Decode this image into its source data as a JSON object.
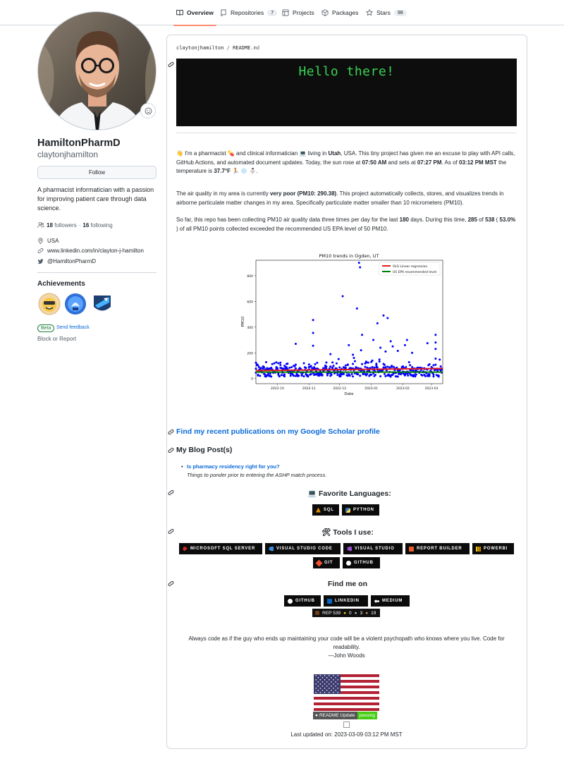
{
  "nav": {
    "tabs": [
      {
        "label": "Overview",
        "icon": "book-icon"
      },
      {
        "label": "Repositories",
        "count": "7",
        "icon": "repo-icon"
      },
      {
        "label": "Projects",
        "icon": "table-icon"
      },
      {
        "label": "Packages",
        "icon": "package-icon"
      },
      {
        "label": "Stars",
        "count": "98",
        "icon": "star-icon"
      }
    ]
  },
  "profile": {
    "name": "HamiltonPharmD",
    "login": "claytonjhamilton",
    "follow_label": "Follow",
    "bio": "A pharmacist informatician with a passion for improving patient care through data science.",
    "followers": "18",
    "followers_label": "followers",
    "separator": "·",
    "following": "16",
    "following_label": "following",
    "location": "USA",
    "website": "www.linkedin.com/in/clayton-j-hamilton",
    "twitter": "@HamiltonPharmD",
    "achievements_title": "Achievements",
    "beta_label": "Beta",
    "feedback_label": "Send feedback",
    "block_label": "Block or Report"
  },
  "readme": {
    "breadcrumb_user": "claytonjhamilton",
    "breadcrumb_sep": "/",
    "breadcrumb_file": "README",
    "breadcrumb_ext": ".md",
    "hello": "Hello there!",
    "intro": {
      "wave": "👋",
      "t1": " I'm a pharmacist ",
      "pill": "💊",
      "t2": " and clinical informatician ",
      "comp": "💻",
      "t3": " living in ",
      "state": "Utah",
      "t4": ", USA. This tiny project has given me an excuse to play with API calls, GitHub Actions, and automated document updates. Today, the sun rose at ",
      "sunrise": "07:50 AM",
      "t5": " and sets at ",
      "sunset": "07:27 PM",
      "t6": ". As of ",
      "asof": "03:12 PM MST",
      "t7": " the temperature is ",
      "temp": "37.7°F",
      "wx": " 🏃 ❄️ ⛄",
      "t8": "."
    },
    "air": {
      "t1": "The air quality in my area is currently ",
      "quality": "very poor (PM10: 290.38)",
      "t2": ". This project automatically collects, stores, and visualizes trends in airborne particulate matter changes in my area. Specifically particulate matter smaller than 10 micrometers (PM10)."
    },
    "stats": {
      "t1": "So far, this repo has been collecting PM10 air quality data three times per day for the last ",
      "days": "180",
      "t2": " days. During this time, ",
      "exceed": "285",
      "t3": " of ",
      "total": "538",
      "t4": " ( ",
      "pct": "53.0%",
      "t5": " ) of all PM10 points collected exceeded the recommended US EPA level of 50 PM10."
    },
    "scholar_link": "Find my recent publications on my Google Scholar profile",
    "blog_heading": "My Blog Post(s)",
    "blog_title": "Is pharmacy residency right for you?",
    "blog_desc": "Things to ponder prior to entering the ASHP match process.",
    "fav_heading": "Favorite Languages:",
    "fav_emoji": "💻",
    "languages": [
      {
        "label": "SQL",
        "color": "#e38c00"
      },
      {
        "label": "PYTHON",
        "color": "#ffdd54"
      }
    ],
    "tools_heading": "Tools I use:",
    "tools_emoji": "🛠",
    "tools_row1": [
      {
        "label": "MICROSOFT SQL SERVER",
        "color": "#cc2927"
      },
      {
        "label": "VISUAL STUDIO CODE",
        "color": "#3a8ee6"
      },
      {
        "label": "VISUAL STUDIO",
        "color": "#9b4fd1"
      },
      {
        "label": "REPORT BUILDER",
        "color": "#e85d2a"
      },
      {
        "label": "POWERBI",
        "color": "#f2c811"
      }
    ],
    "tools_row2": [
      {
        "label": "GIT",
        "color": "#f05033"
      },
      {
        "label": "GITHUB",
        "color": "#ffffff"
      }
    ],
    "findme_heading": "Find me on",
    "socials": [
      {
        "label": "GITHUB",
        "color": "#ffffff"
      },
      {
        "label": "LINKEDIN",
        "color": "#0a66c2"
      },
      {
        "label": "MEDIUM",
        "color": "#ffffff"
      }
    ],
    "rep": {
      "label": "REP 539",
      "gold": "0",
      "silver": "3",
      "bronze": "19"
    },
    "quote": "Always code as if the guy who ends up maintaining your code will be a violent psychopath who knows where you live. Code for readability.",
    "quote_author": "—John Woods",
    "ci_left": "README Update",
    "ci_right": "passing",
    "updated": "Last updated on: 2023-03-09 03:12 PM MST"
  },
  "chart_data": {
    "type": "scatter",
    "title": "PM10 trends in Ogden, UT",
    "xlabel": "Date",
    "ylabel": "PM10",
    "xticks": [
      "2022-10",
      "2022-11",
      "2022-12",
      "2023-01",
      "2023-02",
      "2023-03"
    ],
    "yticks": [
      0,
      200,
      400,
      600,
      800
    ],
    "ylim": [
      -40,
      920
    ],
    "xlim": [
      "2022-09-10",
      "2023-03-12"
    ],
    "legend": [
      "OLS Linear regression",
      "US EPA recommended level"
    ],
    "legend_position": "top-right",
    "colors": {
      "points": "#0000ff",
      "regression": "#e31a1c",
      "epa": "#008000"
    },
    "epa_level": 50,
    "regression": {
      "start": [
        "2022-09-10",
        62
      ],
      "end": [
        "2023-03-12",
        78
      ]
    },
    "outliers": [
      {
        "x": "2022-12-20",
        "y": 900
      },
      {
        "x": "2022-12-21",
        "y": 865
      },
      {
        "x": "2022-12-04",
        "y": 640
      },
      {
        "x": "2022-12-18",
        "y": 545
      },
      {
        "x": "2023-01-07",
        "y": 430
      },
      {
        "x": "2023-01-13",
        "y": 490
      },
      {
        "x": "2023-01-17",
        "y": 470
      },
      {
        "x": "2022-11-05",
        "y": 455
      },
      {
        "x": "2022-11-05",
        "y": 355
      },
      {
        "x": "2022-12-23",
        "y": 340
      },
      {
        "x": "2023-03-05",
        "y": 340
      },
      {
        "x": "2023-01-03",
        "y": 300
      },
      {
        "x": "2023-01-20",
        "y": 290
      },
      {
        "x": "2022-10-19",
        "y": 270
      },
      {
        "x": "2023-02-05",
        "y": 300
      },
      {
        "x": "2023-03-05",
        "y": 280
      },
      {
        "x": "2023-02-25",
        "y": 275
      },
      {
        "x": "2023-01-22",
        "y": 250
      },
      {
        "x": "2023-02-03",
        "y": 260
      },
      {
        "x": "2023-03-05",
        "y": 230
      },
      {
        "x": "2023-01-10",
        "y": 240
      },
      {
        "x": "2022-11-05",
        "y": 255
      },
      {
        "x": "2022-12-10",
        "y": 260
      },
      {
        "x": "2022-12-22",
        "y": 220
      },
      {
        "x": "2023-01-15",
        "y": 210
      },
      {
        "x": "2023-02-10",
        "y": 200
      },
      {
        "x": "2023-01-27",
        "y": 215
      },
      {
        "x": "2022-11-22",
        "y": 190
      },
      {
        "x": "2022-12-14",
        "y": 185
      }
    ],
    "bulk_note": "approx. 500 additional readings between 10 and 160 spanning full date range"
  }
}
